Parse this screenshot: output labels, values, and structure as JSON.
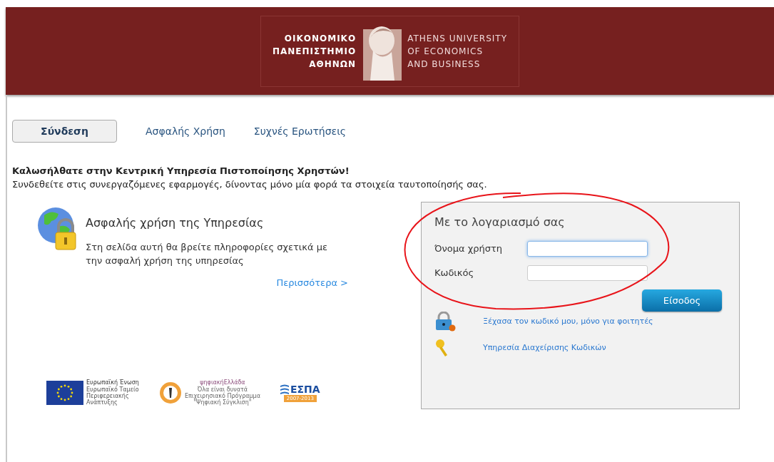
{
  "header": {
    "greek_name": [
      "ΟΙΚΟΝΟΜΙΚΟ",
      "ΠΑΝΕΠΙΣΤΗΜΙΟ",
      "ΑΘΗΝΩΝ"
    ],
    "english_name": [
      "ATHENS UNIVERSITY",
      "OF ECONOMICS",
      "AND BUSINESS"
    ]
  },
  "tabs": [
    {
      "label": "Σύνδεση",
      "selected": true
    },
    {
      "label": "Ασφαλής Χρήση",
      "selected": false
    },
    {
      "label": "Συχνές Ερωτήσεις",
      "selected": false
    }
  ],
  "welcome": {
    "title": "Καλωσήλθατε στην Κεντρική Υπηρεσία Πιστοποίησης Χρηστών!",
    "subtitle": "Συνδεθείτε στις συνεργαζόμενες εφαρμογές, δίνοντας μόνο μία φορά τα στοιχεία ταυτοποίησής σας."
  },
  "info": {
    "title": "Ασφαλής χρήση της Υπηρεσίας",
    "text": "Στη σελίδα αυτή θα βρείτε πληροφορίες σχετικά με την ασφαλή χρήση της υπηρεσίας",
    "link": "Περισσότερα >"
  },
  "login": {
    "title": "Με το λογαριασμό σας",
    "fields": [
      {
        "label": "Όνομα χρήστη",
        "focused": true
      },
      {
        "label": "Κωδικός",
        "focused": false
      }
    ],
    "submit": "Είσοδος",
    "links": [
      {
        "kind": "lock",
        "text": "Ξέχασα τον κωδικό μου, μόνο για φοιτητές"
      },
      {
        "kind": "key",
        "text": "Υπηρεσία Διαχείρισης Κωδικών"
      }
    ]
  },
  "footer_logos": [
    {
      "kind": "eu",
      "lines": [
        "Ευρωπαϊκή Ένωση",
        "Ευρωπαϊκό Ταμείο",
        "Περιφερειακής",
        "Ανάπτυξης"
      ]
    },
    {
      "kind": "digital",
      "lines": [
        "ψηφιακήΕλλάδα",
        "Όλα είναι δυνατά",
        "Επιχειρησιακό Πρόγραμμα",
        "\"Ψηφιακή Σύγκλιση\""
      ]
    },
    {
      "kind": "espa",
      "lines": [
        "ΕΣΠΑ",
        "2007-2013"
      ]
    }
  ]
}
